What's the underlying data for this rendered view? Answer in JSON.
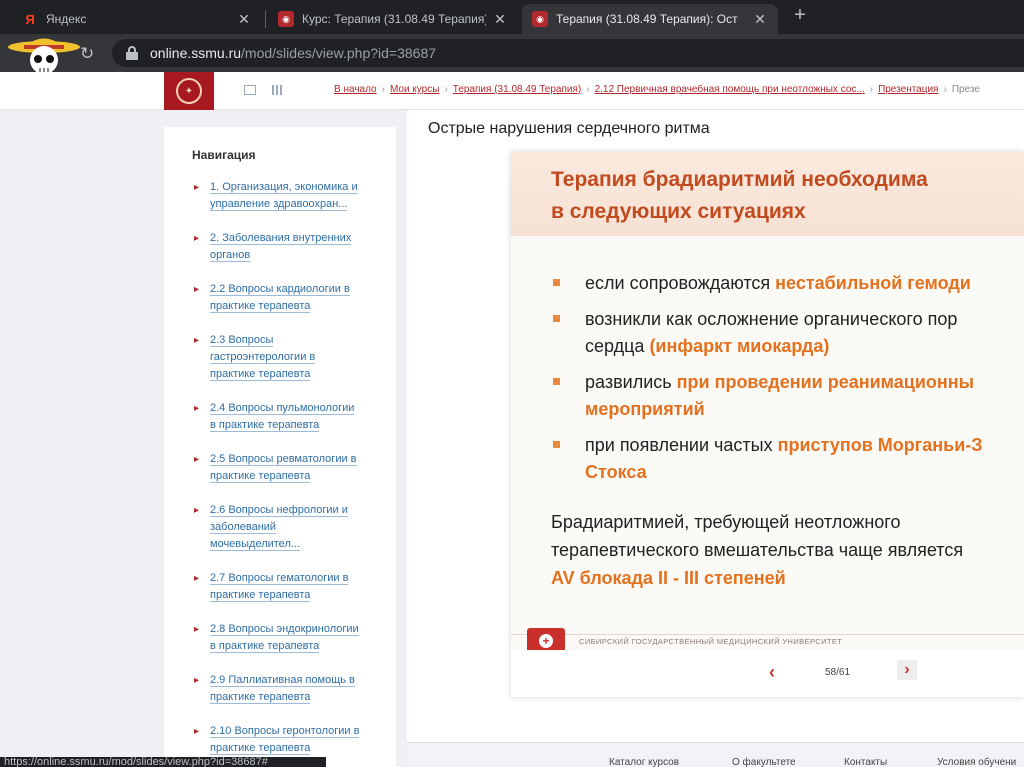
{
  "browser": {
    "tabs": [
      {
        "title": "Яндекс",
        "favicon": "yandex-icon",
        "active": false
      },
      {
        "title": "Курс: Терапия (31.08.49 Терапия)",
        "favicon": "university-seal-icon",
        "active": false
      },
      {
        "title": "Терапия (31.08.49 Терапия): Ост",
        "favicon": "university-seal-icon",
        "active": true
      }
    ],
    "url_host": "online.ssmu.ru",
    "url_path": "/mod/slides/view.php?id=38687",
    "status_url": "https://online.ssmu.ru/mod/slides/view.php?id=38687#"
  },
  "breadcrumb": [
    "В начало",
    "Мои курсы",
    "Терапия (31.08.49 Терапия)",
    "2.12 Первичная врачебная помощь при неотложных сос...",
    "Презентация",
    "Презе"
  ],
  "sidebar": {
    "title": "Навигация",
    "items": [
      {
        "lines": [
          "1. Организация, экономика и",
          "управление здравоохран..."
        ]
      },
      {
        "lines": [
          "2. Заболевания внутренних",
          "органов"
        ]
      },
      {
        "lines": [
          "2.2 Вопросы кардиологии в",
          "практике терапевта"
        ]
      },
      {
        "lines": [
          "2.3 Вопросы",
          "гастроэнтерологии в",
          "практике терапевта"
        ]
      },
      {
        "lines": [
          "2.4 Вопросы пульмонологии",
          "в практике терапевта"
        ]
      },
      {
        "lines": [
          "2.5 Вопросы ревматологии в",
          "практике терапевта"
        ]
      },
      {
        "lines": [
          "2.6 Вопросы нефрологии и",
          "заболеваний",
          "мочевыделител..."
        ]
      },
      {
        "lines": [
          "2.7 Вопросы гематологии в",
          "практике терапевта"
        ]
      },
      {
        "lines": [
          "2.8 Вопросы эндокринологии",
          "в практике терапевта"
        ]
      },
      {
        "lines": [
          "2.9 Паллиативная помощь в",
          "практике терапевта"
        ]
      },
      {
        "lines": [
          "2.10 Вопросы геронтологии в",
          "практике терапевта"
        ]
      }
    ]
  },
  "main": {
    "title": "Острые нарушения сердечного ритма"
  },
  "slide": {
    "heading_line1": "Терапия брадиаритмий необходима",
    "heading_line2": "в следующих ситуациях",
    "bullets": [
      {
        "lines": [
          [
            {
              "t": "если сопровождаются ",
              "hl": false
            },
            {
              "t": "нестабильной гемоди",
              "hl": true
            }
          ]
        ]
      },
      {
        "lines": [
          [
            {
              "t": "возникли как осложнение органического пор",
              "hl": false
            }
          ],
          [
            {
              "t": "сердца ",
              "hl": false
            },
            {
              "t": "(инфаркт миокарда)",
              "hl": true
            }
          ]
        ]
      },
      {
        "lines": [
          [
            {
              "t": "развились ",
              "hl": false
            },
            {
              "t": "при проведении реанимационны",
              "hl": true
            }
          ],
          [
            {
              "t": "мероприятий",
              "hl": true
            }
          ]
        ]
      },
      {
        "lines": [
          [
            {
              "t": "при появлении частых ",
              "hl": false
            },
            {
              "t": "приступов Морганьи-З",
              "hl": true
            }
          ],
          [
            {
              "t": "Стокса",
              "hl": true
            }
          ]
        ]
      }
    ],
    "para_line1": "Брадиаритмией, требующей неотложного",
    "para_line2": "терапевтического вмешательства чаще является",
    "para_line3": "AV блокада II - III степеней",
    "footer_text": "Сибирский государственный медицинский университет"
  },
  "pager": {
    "prev": "‹",
    "current": "58/61",
    "next": "›"
  },
  "footer_links": [
    "Каталог курсов",
    "О факультете",
    "Контакты",
    "Условия обучени"
  ],
  "colors": {
    "brand": "#a7191f",
    "accent": "#e4711e",
    "link": "#2f6ea5"
  }
}
